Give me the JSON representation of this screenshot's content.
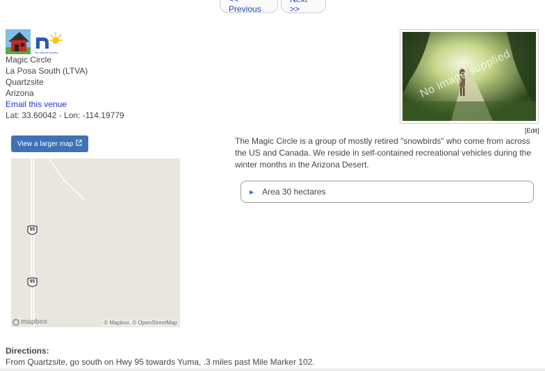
{
  "pager": {
    "previous_label": "<< Previous",
    "next_label": "Next >>"
  },
  "logos": {
    "tns_caption": "the naturist society"
  },
  "venue": {
    "name": "Magic Circle",
    "location": "La Posa South (LTVA)",
    "city": "Quartzsite",
    "state": "Arizona",
    "email_link": "Email this venue",
    "coords": "Lat: 33.60042 - Lon: -114.19779"
  },
  "photo": {
    "watermark": "No image supplied",
    "edit_label": "[Edit]"
  },
  "map": {
    "button_label": "View a larger map",
    "route_shield_1": "95",
    "route_shield_2": "95",
    "credit": "© Mapbox, © OpenStreetMap",
    "logo_text": "mapbox"
  },
  "description": {
    "text": "The Magic Circle is a group of mostly retired \"snowbirds\" who come from across the US and Canada. We reside in self-contained recreational vehicles during the winter months in the Arizona Desert."
  },
  "details": {
    "label": "Area 30 hectares"
  },
  "directions": {
    "label": "Directions:",
    "text": "From Quartzsite, go south on Hwy 95 towards Yuma, .3 miles past Mile Marker 102."
  },
  "colors": {
    "link": "#1a35d6",
    "button": "#3d72b8",
    "map_bg": "#e9e6df"
  }
}
